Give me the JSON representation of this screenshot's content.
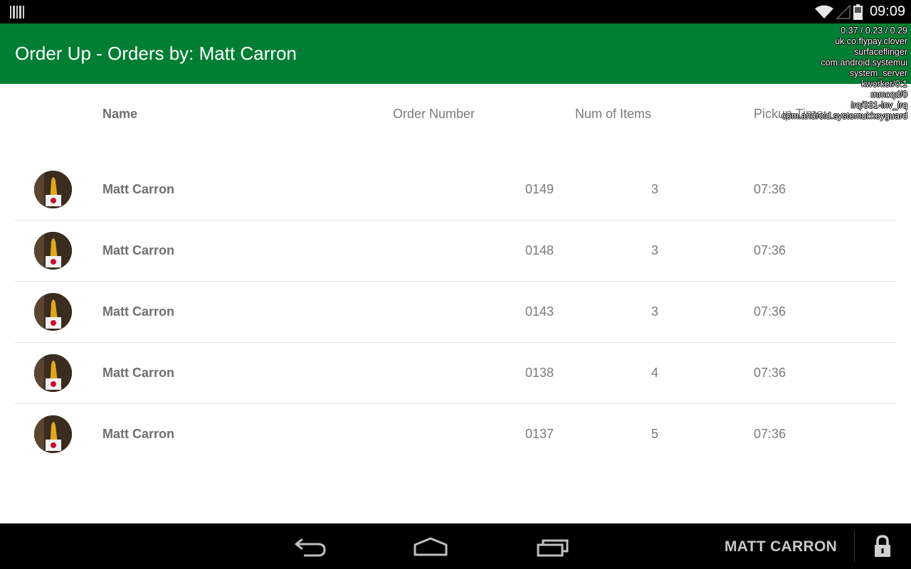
{
  "status_bar": {
    "time": "09:09",
    "left_icon": "barcode-icon",
    "icons": [
      "wifi-icon",
      "no-signal-icon",
      "battery-icon"
    ]
  },
  "action_bar": {
    "title": "Order Up - Orders by: Matt Carron",
    "color": "#007e33"
  },
  "debug_overlay": {
    "lines": [
      "0.37 / 0.23 / 0.29",
      "uk.co.flypay.clover",
      "surfaceflinger",
      "com.android.systemui",
      "system_server",
      "kworker/0:1",
      "mmcqd/0",
      "irq/331-inv_irq",
      "com.android.systemui:keyguard"
    ]
  },
  "table": {
    "headers": {
      "name": "Name",
      "order_number": "Order Number",
      "num_items": "Num of Items",
      "pickup_time": "Pickup Time"
    },
    "rows": [
      {
        "name": "Matt Carron",
        "order_number": "0149",
        "num_items": "3",
        "pickup_time": "07:36"
      },
      {
        "name": "Matt Carron",
        "order_number": "0148",
        "num_items": "3",
        "pickup_time": "07:36"
      },
      {
        "name": "Matt Carron",
        "order_number": "0143",
        "num_items": "3",
        "pickup_time": "07:36"
      },
      {
        "name": "Matt Carron",
        "order_number": "0138",
        "num_items": "4",
        "pickup_time": "07:36"
      },
      {
        "name": "Matt Carron",
        "order_number": "0137",
        "num_items": "5",
        "pickup_time": "07:36"
      }
    ]
  },
  "nav_bar": {
    "user_label": "MATT CARRON",
    "icons": [
      "back-icon",
      "home-icon",
      "recent-apps-icon",
      "lock-icon"
    ]
  }
}
